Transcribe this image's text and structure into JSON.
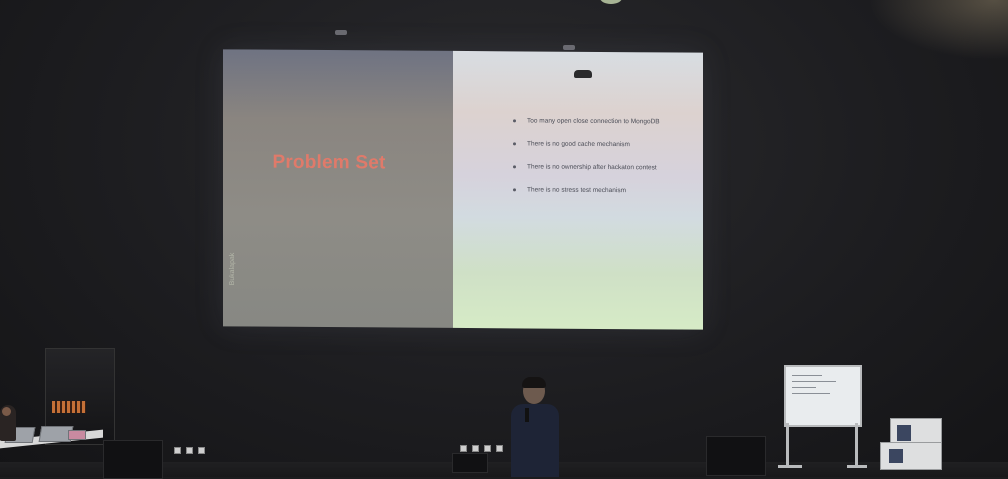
{
  "slide": {
    "title": "Problem Set",
    "vertical_text": "Bukalapak",
    "bullets": [
      "Too many open close connection to MongoDB",
      "There is no good cache mechanism",
      "There is no ownership after hackaton contest",
      "There is no stress test mechanism"
    ],
    "title_color": "#e07a6a"
  }
}
